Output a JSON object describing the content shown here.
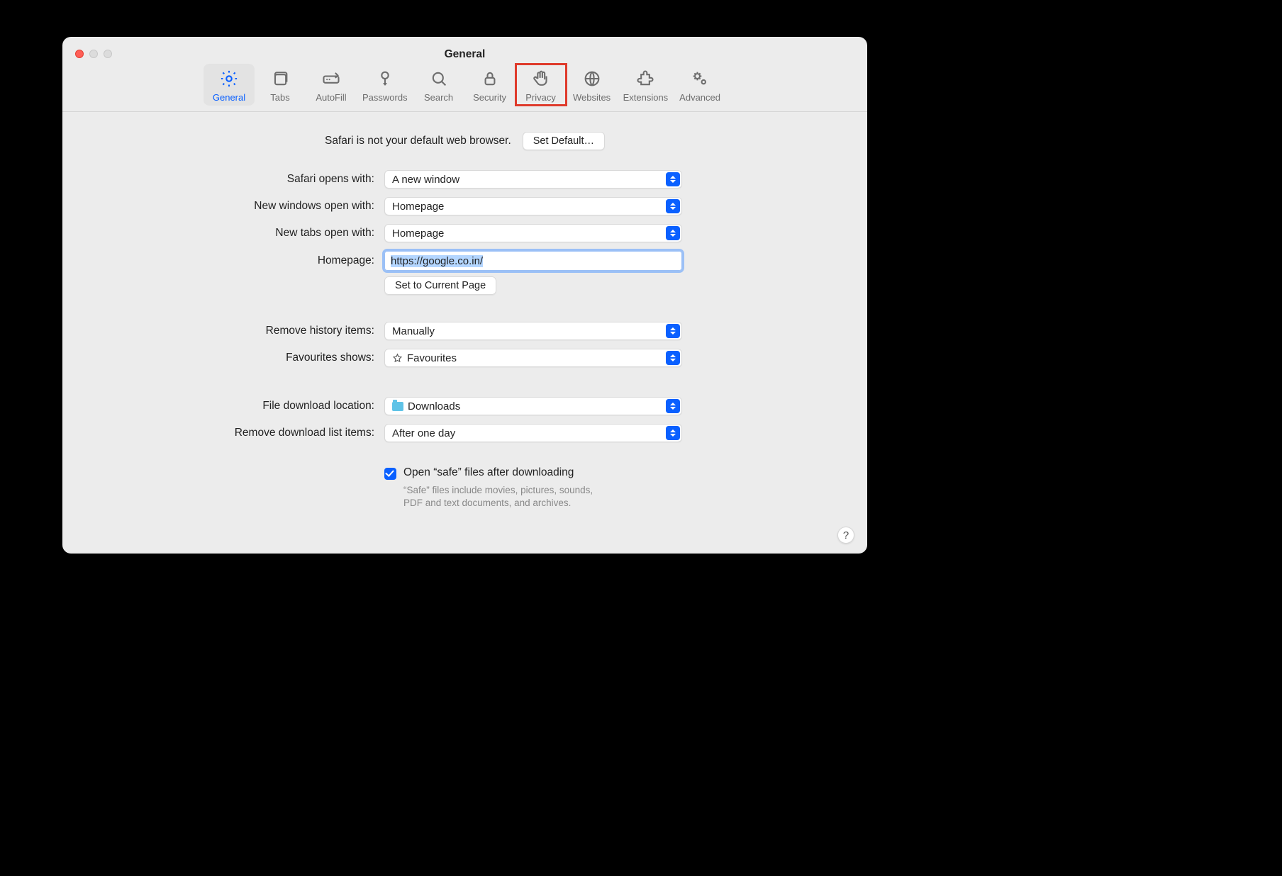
{
  "window": {
    "title": "General"
  },
  "toolbar": {
    "items": [
      {
        "label": "General"
      },
      {
        "label": "Tabs"
      },
      {
        "label": "AutoFill"
      },
      {
        "label": "Passwords"
      },
      {
        "label": "Search"
      },
      {
        "label": "Security"
      },
      {
        "label": "Privacy"
      },
      {
        "label": "Websites"
      },
      {
        "label": "Extensions"
      },
      {
        "label": "Advanced"
      }
    ]
  },
  "defaultBrowser": {
    "message": "Safari is not your default web browser.",
    "button": "Set Default…"
  },
  "form": {
    "opensWith": {
      "label": "Safari opens with:",
      "value": "A new window"
    },
    "newWindows": {
      "label": "New windows open with:",
      "value": "Homepage"
    },
    "newTabs": {
      "label": "New tabs open with:",
      "value": "Homepage"
    },
    "homepage": {
      "label": "Homepage:",
      "value": "https://google.co.in/"
    },
    "setCurrent": {
      "button": "Set to Current Page"
    },
    "removeHistory": {
      "label": "Remove history items:",
      "value": "Manually"
    },
    "favourites": {
      "label": "Favourites shows:",
      "value": "Favourites"
    },
    "downloadLocation": {
      "label": "File download location:",
      "value": "Downloads"
    },
    "removeDownloads": {
      "label": "Remove download list items:",
      "value": "After one day"
    },
    "safeFiles": {
      "label": "Open “safe” files after downloading",
      "hint1": "“Safe” files include movies, pictures, sounds,",
      "hint2": "PDF and text documents, and archives."
    }
  },
  "help": "?"
}
